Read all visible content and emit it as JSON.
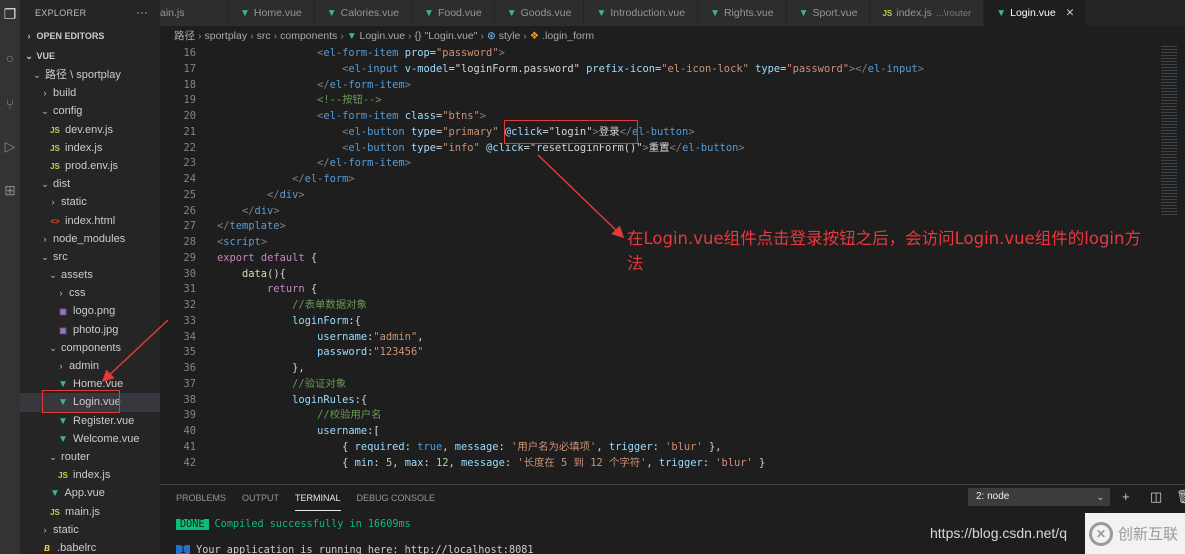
{
  "activity_bar": {
    "icons": [
      "explorer-icon",
      "search-icon",
      "source-control-icon",
      "debug-icon",
      "extensions-icon"
    ]
  },
  "sidebar": {
    "title": "EXPLORER",
    "more": "···",
    "open_editors": "OPEN EDITORS",
    "workspace": "VUE",
    "tree": [
      {
        "label": "路径 \\ sportplay",
        "type": "folder",
        "open": true,
        "depth": 1
      },
      {
        "label": "build",
        "type": "folder",
        "open": false,
        "depth": 2
      },
      {
        "label": "config",
        "type": "folder",
        "open": true,
        "depth": 2
      },
      {
        "label": "dev.env.js",
        "type": "js",
        "depth": 3
      },
      {
        "label": "index.js",
        "type": "js",
        "depth": 3
      },
      {
        "label": "prod.env.js",
        "type": "js",
        "depth": 3
      },
      {
        "label": "dist",
        "type": "folder",
        "open": true,
        "depth": 2
      },
      {
        "label": "static",
        "type": "folder",
        "open": false,
        "depth": 3
      },
      {
        "label": "index.html",
        "type": "html",
        "depth": 3
      },
      {
        "label": "node_modules",
        "type": "folder",
        "open": false,
        "depth": 2
      },
      {
        "label": "src",
        "type": "folder",
        "open": true,
        "depth": 2
      },
      {
        "label": "assets",
        "type": "folder",
        "open": true,
        "depth": 3
      },
      {
        "label": "css",
        "type": "folder",
        "open": false,
        "depth": 4
      },
      {
        "label": "logo.png",
        "type": "img",
        "depth": 4
      },
      {
        "label": "photo.jpg",
        "type": "img",
        "depth": 4
      },
      {
        "label": "components",
        "type": "folder",
        "open": true,
        "depth": 3
      },
      {
        "label": "admin",
        "type": "folder",
        "open": false,
        "depth": 4
      },
      {
        "label": "Home.vue",
        "type": "vue",
        "depth": 4
      },
      {
        "label": "Login.vue",
        "type": "vue",
        "depth": 4,
        "selected": true
      },
      {
        "label": "Register.vue",
        "type": "vue",
        "depth": 4
      },
      {
        "label": "Welcome.vue",
        "type": "vue",
        "depth": 4
      },
      {
        "label": "router",
        "type": "folder",
        "open": true,
        "depth": 3
      },
      {
        "label": "index.js",
        "type": "js",
        "depth": 4
      },
      {
        "label": "App.vue",
        "type": "vue",
        "depth": 3
      },
      {
        "label": "main.js",
        "type": "js",
        "depth": 3
      },
      {
        "label": "static",
        "type": "folder",
        "open": false,
        "depth": 2
      },
      {
        "label": ".babelrc",
        "type": "babel",
        "depth": 2
      }
    ]
  },
  "tabs": [
    {
      "label": "main.js",
      "type": "js-hidden"
    },
    {
      "label": "Home.vue",
      "type": "vue"
    },
    {
      "label": "Calories.vue",
      "type": "vue"
    },
    {
      "label": "Food.vue",
      "type": "vue"
    },
    {
      "label": "Goods.vue",
      "type": "vue"
    },
    {
      "label": "Introduction.vue",
      "type": "vue"
    },
    {
      "label": "Rights.vue",
      "type": "vue"
    },
    {
      "label": "Sport.vue",
      "type": "vue"
    },
    {
      "label": "index.js",
      "type": "js",
      "desc": "...\\router"
    },
    {
      "label": "Login.vue",
      "type": "vue",
      "active": true,
      "close": "✕"
    }
  ],
  "breadcrumb": [
    "路径",
    "sportplay",
    "src",
    "components",
    "Login.vue",
    "{} \"Login.vue\"",
    "style",
    ".login_form"
  ],
  "editor": {
    "lines": [
      {
        "n": "16",
        "indent": 8,
        "tokens": [
          [
            "br",
            "<"
          ],
          [
            "tag",
            "el-form-item"
          ],
          [
            "txt",
            " "
          ],
          [
            "attr",
            "prop"
          ],
          [
            "txt",
            "="
          ],
          [
            "str",
            "\"password\""
          ],
          [
            "br",
            ">"
          ]
        ]
      },
      {
        "n": "17",
        "indent": 10,
        "tokens": [
          [
            "br",
            "<"
          ],
          [
            "tag",
            "el-input"
          ],
          [
            "txt",
            " "
          ],
          [
            "attr",
            "v-model"
          ],
          [
            "txt",
            "="
          ],
          [
            "txt",
            "\"loginForm.password\""
          ],
          [
            "txt",
            " "
          ],
          [
            "attr",
            "prefix-icon"
          ],
          [
            "txt",
            "="
          ],
          [
            "str",
            "\"el-icon-lock\""
          ],
          [
            "txt",
            " "
          ],
          [
            "attr",
            "type"
          ],
          [
            "txt",
            "="
          ],
          [
            "str",
            "\"password\""
          ],
          [
            "br",
            ">"
          ],
          [
            "br",
            "</"
          ],
          [
            "tag",
            "el-input"
          ],
          [
            "br",
            ">"
          ]
        ]
      },
      {
        "n": "18",
        "indent": 8,
        "tokens": [
          [
            "br",
            "</"
          ],
          [
            "tag",
            "el-form-item"
          ],
          [
            "br",
            ">"
          ]
        ]
      },
      {
        "n": "19",
        "indent": 8,
        "tokens": [
          [
            "com",
            "<!--按钮-->"
          ]
        ]
      },
      {
        "n": "20",
        "indent": 8,
        "tokens": [
          [
            "br",
            "<"
          ],
          [
            "tag",
            "el-form-item"
          ],
          [
            "txt",
            " "
          ],
          [
            "attr",
            "class"
          ],
          [
            "txt",
            "="
          ],
          [
            "str",
            "\"btns\""
          ],
          [
            "br",
            ">"
          ]
        ]
      },
      {
        "n": "21",
        "indent": 10,
        "tokens": [
          [
            "br",
            "<"
          ],
          [
            "tag",
            "el-button"
          ],
          [
            "txt",
            " "
          ],
          [
            "attr",
            "type"
          ],
          [
            "txt",
            "="
          ],
          [
            "str",
            "\"primary\""
          ],
          [
            "txt",
            " "
          ],
          [
            "attr",
            "@click"
          ],
          [
            "txt",
            "="
          ],
          [
            "txt",
            "\"login\""
          ],
          [
            "br",
            ">"
          ],
          [
            "txt",
            "登录"
          ],
          [
            "br",
            "</"
          ],
          [
            "tag",
            "el-button"
          ],
          [
            "br",
            ">"
          ]
        ]
      },
      {
        "n": "22",
        "indent": 10,
        "tokens": [
          [
            "br",
            "<"
          ],
          [
            "tag",
            "el-button"
          ],
          [
            "txt",
            " "
          ],
          [
            "attr",
            "type"
          ],
          [
            "txt",
            "="
          ],
          [
            "str",
            "\"info\""
          ],
          [
            "txt",
            " "
          ],
          [
            "attr",
            "@click"
          ],
          [
            "txt",
            "="
          ],
          [
            "txt",
            "\"resetLoginForm()\""
          ],
          [
            "br",
            ">"
          ],
          [
            "txt",
            "重置"
          ],
          [
            "br",
            "</"
          ],
          [
            "tag",
            "el-button"
          ],
          [
            "br",
            ">"
          ]
        ]
      },
      {
        "n": "23",
        "indent": 8,
        "tokens": [
          [
            "br",
            "</"
          ],
          [
            "tag",
            "el-form-item"
          ],
          [
            "br",
            ">"
          ]
        ]
      },
      {
        "n": "24",
        "indent": 6,
        "tokens": [
          [
            "br",
            "</"
          ],
          [
            "tag",
            "el-form"
          ],
          [
            "br",
            ">"
          ]
        ]
      },
      {
        "n": "25",
        "indent": 4,
        "tokens": [
          [
            "br",
            "</"
          ],
          [
            "tag",
            "div"
          ],
          [
            "br",
            ">"
          ]
        ]
      },
      {
        "n": "26",
        "indent": 2,
        "tokens": [
          [
            "br",
            "</"
          ],
          [
            "tag",
            "div"
          ],
          [
            "br",
            ">"
          ]
        ]
      },
      {
        "n": "27",
        "indent": 0,
        "tokens": [
          [
            "br",
            "</"
          ],
          [
            "tag",
            "template"
          ],
          [
            "br",
            ">"
          ]
        ]
      },
      {
        "n": "28",
        "indent": 0,
        "tokens": [
          [
            "br",
            "<"
          ],
          [
            "tag",
            "script"
          ],
          [
            "br",
            ">"
          ]
        ]
      },
      {
        "n": "29",
        "indent": 0,
        "tokens": [
          [
            "kw",
            "export"
          ],
          [
            "txt",
            " "
          ],
          [
            "kw",
            "default"
          ],
          [
            "txt",
            " {"
          ]
        ]
      },
      {
        "n": "30",
        "indent": 2,
        "tokens": [
          [
            "fn",
            "data"
          ],
          [
            "txt",
            "(){"
          ]
        ]
      },
      {
        "n": "31",
        "indent": 4,
        "tokens": [
          [
            "kw",
            "return"
          ],
          [
            "txt",
            " {"
          ]
        ]
      },
      {
        "n": "32",
        "indent": 6,
        "tokens": [
          [
            "com",
            "//表单数据对象"
          ]
        ]
      },
      {
        "n": "33",
        "indent": 6,
        "tokens": [
          [
            "prop",
            "loginForm"
          ],
          [
            "txt",
            ":{"
          ]
        ]
      },
      {
        "n": "34",
        "indent": 8,
        "tokens": [
          [
            "prop",
            "username"
          ],
          [
            "txt",
            ":"
          ],
          [
            "str",
            "\"admin\""
          ],
          [
            "txt",
            ","
          ]
        ]
      },
      {
        "n": "35",
        "indent": 8,
        "tokens": [
          [
            "prop",
            "password"
          ],
          [
            "txt",
            ":"
          ],
          [
            "str",
            "\"123456\""
          ]
        ]
      },
      {
        "n": "36",
        "indent": 6,
        "tokens": [
          [
            "txt",
            "},"
          ]
        ]
      },
      {
        "n": "37",
        "indent": 6,
        "tokens": [
          [
            "com",
            "//验证对象"
          ]
        ]
      },
      {
        "n": "38",
        "indent": 6,
        "tokens": [
          [
            "prop",
            "loginRules"
          ],
          [
            "txt",
            ":{"
          ]
        ]
      },
      {
        "n": "39",
        "indent": 8,
        "tokens": [
          [
            "com",
            "//校验用户名"
          ]
        ]
      },
      {
        "n": "40",
        "indent": 8,
        "tokens": [
          [
            "prop",
            "username"
          ],
          [
            "txt",
            ":["
          ]
        ]
      },
      {
        "n": "41",
        "indent": 10,
        "tokens": [
          [
            "txt",
            "{ "
          ],
          [
            "prop",
            "required"
          ],
          [
            "txt",
            ": "
          ],
          [
            "bool",
            "true"
          ],
          [
            "txt",
            ", "
          ],
          [
            "prop",
            "message"
          ],
          [
            "txt",
            ": "
          ],
          [
            "str",
            "'用户名为必填项'"
          ],
          [
            "txt",
            ", "
          ],
          [
            "prop",
            "trigger"
          ],
          [
            "txt",
            ": "
          ],
          [
            "str",
            "'blur'"
          ],
          [
            "txt",
            " },"
          ]
        ]
      },
      {
        "n": "42",
        "indent": 10,
        "tokens": [
          [
            "txt",
            "{ "
          ],
          [
            "prop",
            "min"
          ],
          [
            "txt",
            ": "
          ],
          [
            "num",
            "5"
          ],
          [
            "txt",
            ", "
          ],
          [
            "prop",
            "max"
          ],
          [
            "txt",
            ": "
          ],
          [
            "num",
            "12"
          ],
          [
            "txt",
            ", "
          ],
          [
            "prop",
            "message"
          ],
          [
            "txt",
            ": "
          ],
          [
            "str",
            "'长度在 5 到 12 个字符'"
          ],
          [
            "txt",
            ", "
          ],
          [
            "prop",
            "trigger"
          ],
          [
            "txt",
            ": "
          ],
          [
            "str",
            "'blur'"
          ],
          [
            "txt",
            " }"
          ]
        ]
      }
    ]
  },
  "annotation": {
    "text": "在Login.vue组件点击登录按钮之后，会访问Login.vue组件的login方法",
    "color": "#e8383d"
  },
  "panel": {
    "tabs": [
      "PROBLEMS",
      "OUTPUT",
      "TERMINAL",
      "DEBUG CONSOLE"
    ],
    "active_tab": "TERMINAL",
    "terminal_select": "2: node",
    "actions": [
      "add-terminal-icon",
      "split-terminal-icon",
      "trash-icon"
    ],
    "lines": [
      {
        "badge": "DONE",
        "text": "Compiled successfully in 16609ms"
      },
      {
        "badge": "I",
        "text": "Your application is running here: http://localhost:8081"
      }
    ]
  },
  "watermark": {
    "url": "https://blog.csdn.net/q",
    "brand": "创新互联"
  }
}
